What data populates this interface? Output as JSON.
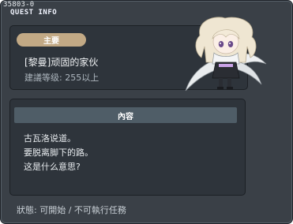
{
  "quest": {
    "id": "35803-0",
    "header_label": "QUEST INFO",
    "category": "主要",
    "name": "[黎曼]顽固的家伙",
    "level_requirement": "建議等级: 255以上",
    "content_title": "內容",
    "content_lines": [
      "古瓦洛说道。",
      "要脱离脚下的路。",
      "这是什么意思?"
    ],
    "status": "狀態: 可開始 / 不可執行任務"
  },
  "colors": {
    "window_bg": "#3a4047",
    "panel_bg": "#2e343b",
    "tag_bg": "#c2a985",
    "header_bar": "#4f5d67"
  }
}
